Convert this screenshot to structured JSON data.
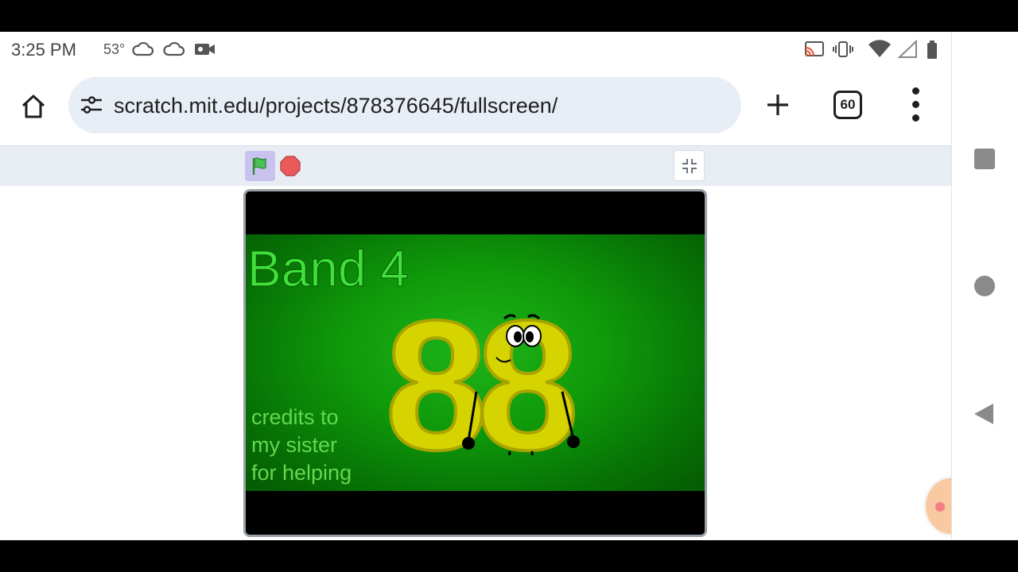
{
  "status_bar": {
    "time": "3:25 PM",
    "temperature": "53°",
    "icons": [
      "cloud-icon",
      "cloud-icon",
      "video-camera-icon",
      "cast-icon",
      "vibrate-icon",
      "wifi-icon",
      "signal-icon",
      "battery-icon"
    ]
  },
  "browser": {
    "url": "scratch.mit.edu/projects/878376645/fullscreen/",
    "tab_count": "60",
    "icons": [
      "home-icon",
      "site-settings-icon",
      "new-tab-plus-icon",
      "tab-switcher-icon",
      "more-menu-icon"
    ]
  },
  "scratch_controls": {
    "icons": [
      "green-flag-icon",
      "stop-sign-icon",
      "exit-fullscreen-icon"
    ],
    "flag_color": "#4cbf56",
    "stop_color": "#ec5959",
    "bar_color": "#e7edf3"
  },
  "stage": {
    "title": "Band 4",
    "big_number": "88",
    "credits_lines": [
      "credits to",
      "my sister",
      "for helping"
    ],
    "background_color": "#0f9a0a",
    "number_color": "#d6d400"
  },
  "system_nav": {
    "icons": [
      "recents-square-icon",
      "home-circle-icon",
      "back-triangle-icon"
    ]
  }
}
